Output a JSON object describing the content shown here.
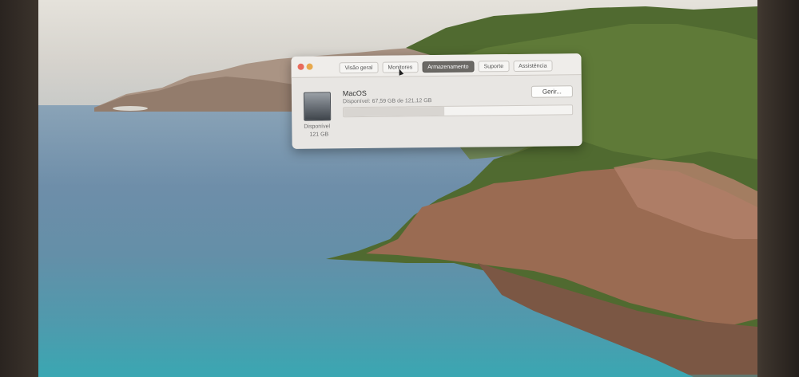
{
  "window": {
    "tabs": [
      {
        "label": "Visão geral",
        "active": false
      },
      {
        "label": "Monitores",
        "active": false
      },
      {
        "label": "Armazenamento",
        "active": true
      },
      {
        "label": "Suporte",
        "active": false
      },
      {
        "label": "Assistência",
        "active": false
      }
    ],
    "disk": {
      "name": "MacOS",
      "available_text": "Disponível: 67,59 GB de 121,12 GB",
      "used_fraction": 0.44,
      "manage_label": "Gerir...",
      "legend_label": "Disponível",
      "legend_value": "121 GB"
    }
  },
  "colors": {
    "sky": "#dcd9d2",
    "sea": "#5f8ea5",
    "lagoon": "#3aa7b2",
    "cliff": "#9b6e55",
    "vegetation": "#4f6b2f",
    "tab_active": "#6b6965",
    "close_button": "#e86b5c",
    "minimize_button": "#e7a94c"
  }
}
